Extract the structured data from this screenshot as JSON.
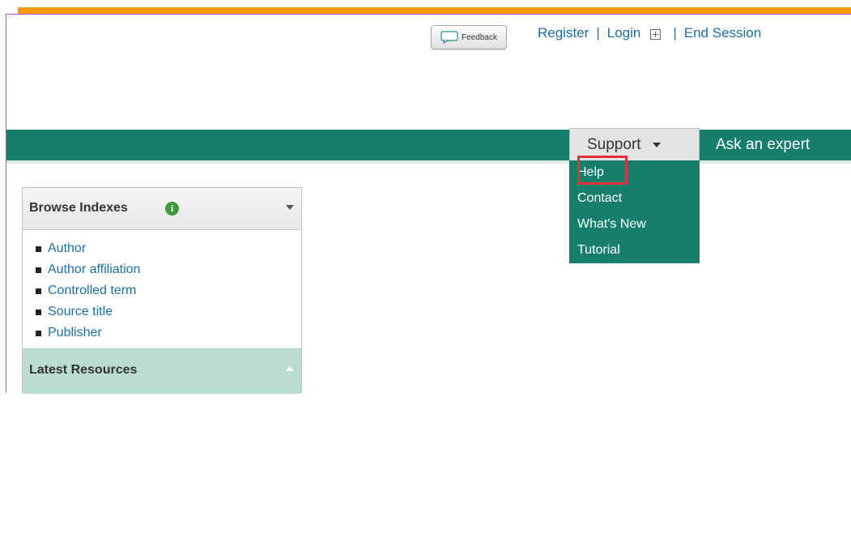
{
  "header": {
    "feedback_label": "Feedback",
    "links": {
      "register": "Register",
      "login": "Login",
      "end_session": "End Session",
      "separator": "|"
    }
  },
  "nav": {
    "support_label": "Support",
    "ask_expert_label": "Ask an expert",
    "support_menu": [
      "Help",
      "Contact",
      "What's New",
      "Tutorial"
    ]
  },
  "browse_panel": {
    "title": "Browse Indexes",
    "info_icon": "i",
    "items": [
      "Author",
      "Author affiliation",
      "Controlled term",
      "Source title",
      "Publisher"
    ]
  },
  "latest_panel": {
    "title": "Latest Resources"
  },
  "colors": {
    "accent_orange": "#f39a0b",
    "nav_green": "#167f6c",
    "link_blue": "#1b6fa8",
    "highlight_red": "#e0313c"
  }
}
